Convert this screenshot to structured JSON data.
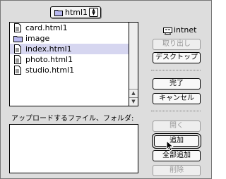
{
  "folder_popup": {
    "label": "html1",
    "folder_icon": "folder-icon",
    "arrows_icon": "updown-arrows-icon"
  },
  "file_list": {
    "items": [
      {
        "name": "card.html1",
        "icon": "document-icon",
        "selected": false
      },
      {
        "name": "image",
        "icon": "folder-icon",
        "selected": false
      },
      {
        "name": "index.html1",
        "icon": "document-icon",
        "selected": true
      },
      {
        "name": "photo.html1",
        "icon": "document-icon",
        "selected": false
      },
      {
        "name": "studio.html1",
        "icon": "document-icon",
        "selected": false
      }
    ]
  },
  "disk": {
    "name": "intnet",
    "icon": "disk-icon"
  },
  "buttons": {
    "eject": "取り出し",
    "desktop": "デスクトップ",
    "done": "完了",
    "cancel": "キャンセル",
    "open": "開く",
    "add": "追加",
    "add_all": "全部追加",
    "remove": "削除"
  },
  "upload": {
    "label": "アップロードするファイル、フォルダ:",
    "items": []
  },
  "colors": {
    "selection": "#d6d6f0",
    "dialog_bg": "#dddddd"
  }
}
